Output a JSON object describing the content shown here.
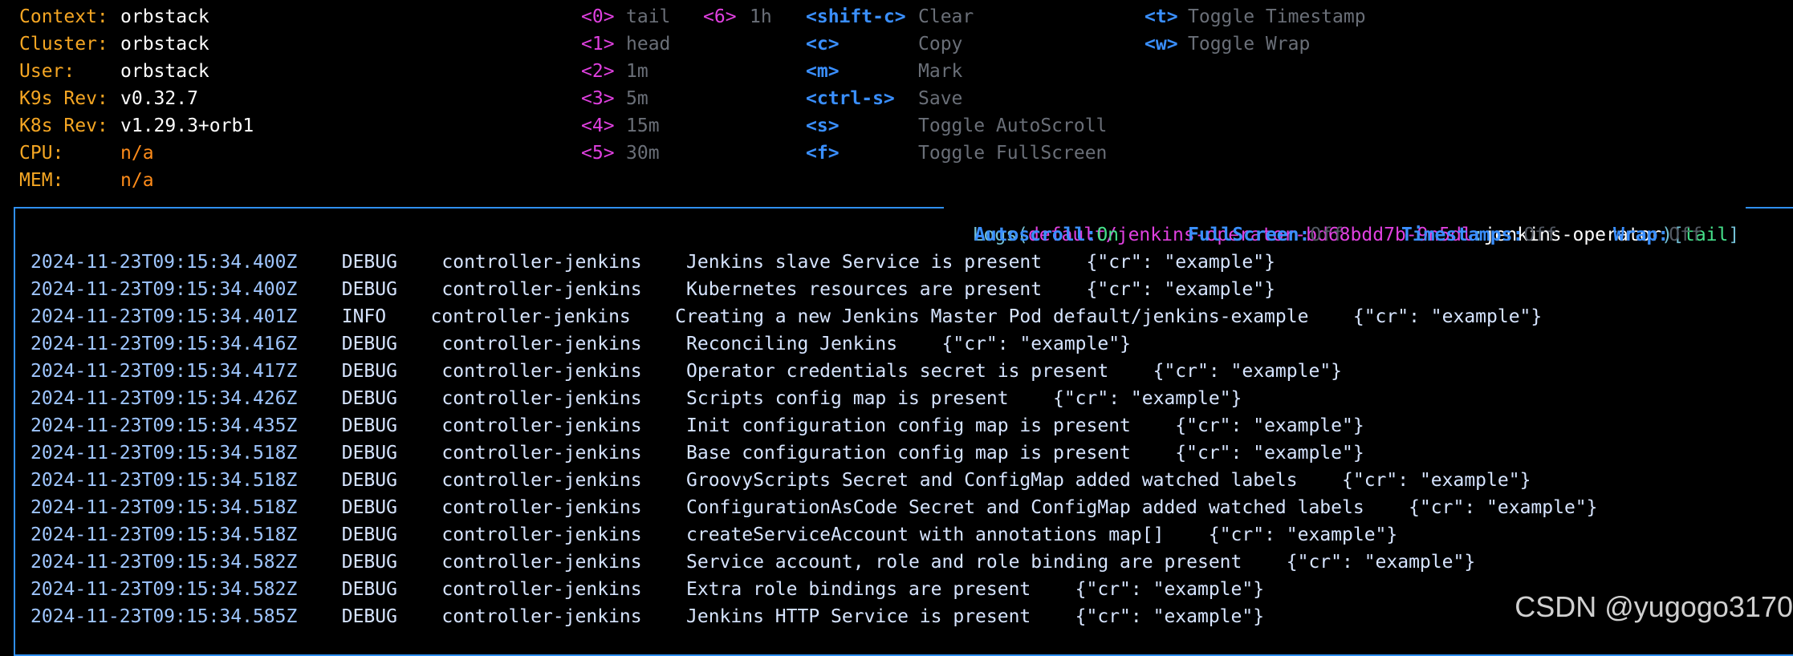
{
  "info": [
    {
      "label": "Context:",
      "value": "orbstack",
      "warn": false
    },
    {
      "label": "Cluster:",
      "value": "orbstack",
      "warn": false
    },
    {
      "label": "User:",
      "value": "orbstack",
      "warn": false
    },
    {
      "label": "K9s Rev:",
      "value": "v0.32.7",
      "warn": false
    },
    {
      "label": "K8s Rev:",
      "value": "v1.29.3+orb1",
      "warn": false
    },
    {
      "label": "CPU:",
      "value": "n/a",
      "warn": true
    },
    {
      "label": "MEM:",
      "value": "n/a",
      "warn": true
    }
  ],
  "time_keys": [
    {
      "key": "<0>",
      "label": "tail"
    },
    {
      "key": "<1>",
      "label": "head"
    },
    {
      "key": "<2>",
      "label": "1m"
    },
    {
      "key": "<3>",
      "label": "5m"
    },
    {
      "key": "<4>",
      "label": "15m"
    },
    {
      "key": "<5>",
      "label": "30m"
    }
  ],
  "time_key_extra": {
    "key": "<6>",
    "label": "1h"
  },
  "action_keys": [
    {
      "key": "<shift-c>",
      "label": "Clear"
    },
    {
      "key": "<c>",
      "label": "Copy"
    },
    {
      "key": "<m>",
      "label": "Mark"
    },
    {
      "key": "<ctrl-s>",
      "label": "Save"
    },
    {
      "key": "<s>",
      "label": "Toggle AutoScroll"
    },
    {
      "key": "<f>",
      "label": "Toggle FullScreen"
    }
  ],
  "toggle_keys": [
    {
      "key": "<t>",
      "label": "Toggle Timestamp"
    },
    {
      "key": "<w>",
      "label": "Toggle Wrap"
    }
  ],
  "title": {
    "prefix": "Logs(",
    "path": "default/jenkins-operator-bd68bdd7b-9n5dl",
    "sep": ":",
    "container": "jenkins-operator",
    "close": ")[",
    "mode": "tail",
    "end": "]"
  },
  "status": [
    {
      "label": "Autoscroll:",
      "value": "On",
      "on": true
    },
    {
      "label": "FullScreen:",
      "value": "Off",
      "on": false
    },
    {
      "label": "Timestamps:",
      "value": "Off",
      "on": false
    },
    {
      "label": "Wrap:",
      "value": "Off",
      "on": false
    }
  ],
  "logs": [
    {
      "ts": "2024-11-23T09:15:34.400Z",
      "level": "DEBUG",
      "logger": "controller-jenkins",
      "msg": "Jenkins slave Service is present",
      "ctx": "{\"cr\": \"example\"}"
    },
    {
      "ts": "2024-11-23T09:15:34.400Z",
      "level": "DEBUG",
      "logger": "controller-jenkins",
      "msg": "Kubernetes resources are present",
      "ctx": "{\"cr\": \"example\"}"
    },
    {
      "ts": "2024-11-23T09:15:34.401Z",
      "level": "INFO",
      "logger": "controller-jenkins",
      "msg": "Creating a new Jenkins Master Pod default/jenkins-example",
      "ctx": "{\"cr\": \"example\"}"
    },
    {
      "ts": "2024-11-23T09:15:34.416Z",
      "level": "DEBUG",
      "logger": "controller-jenkins",
      "msg": "Reconciling Jenkins",
      "ctx": "{\"cr\": \"example\"}"
    },
    {
      "ts": "2024-11-23T09:15:34.417Z",
      "level": "DEBUG",
      "logger": "controller-jenkins",
      "msg": "Operator credentials secret is present",
      "ctx": "{\"cr\": \"example\"}"
    },
    {
      "ts": "2024-11-23T09:15:34.426Z",
      "level": "DEBUG",
      "logger": "controller-jenkins",
      "msg": "Scripts config map is present",
      "ctx": "{\"cr\": \"example\"}"
    },
    {
      "ts": "2024-11-23T09:15:34.435Z",
      "level": "DEBUG",
      "logger": "controller-jenkins",
      "msg": "Init configuration config map is present",
      "ctx": "{\"cr\": \"example\"}"
    },
    {
      "ts": "2024-11-23T09:15:34.518Z",
      "level": "DEBUG",
      "logger": "controller-jenkins",
      "msg": "Base configuration config map is present",
      "ctx": "{\"cr\": \"example\"}"
    },
    {
      "ts": "2024-11-23T09:15:34.518Z",
      "level": "DEBUG",
      "logger": "controller-jenkins",
      "msg": "GroovyScripts Secret and ConfigMap added watched labels",
      "ctx": "{\"cr\": \"example\"}"
    },
    {
      "ts": "2024-11-23T09:15:34.518Z",
      "level": "DEBUG",
      "logger": "controller-jenkins",
      "msg": "ConfigurationAsCode Secret and ConfigMap added watched labels",
      "ctx": "{\"cr\": \"example\"}"
    },
    {
      "ts": "2024-11-23T09:15:34.518Z",
      "level": "DEBUG",
      "logger": "controller-jenkins",
      "msg": "createServiceAccount with annotations map[]",
      "ctx": "{\"cr\": \"example\"}"
    },
    {
      "ts": "2024-11-23T09:15:34.582Z",
      "level": "DEBUG",
      "logger": "controller-jenkins",
      "msg": "Service account, role and role binding are present",
      "ctx": "{\"cr\": \"example\"}"
    },
    {
      "ts": "2024-11-23T09:15:34.582Z",
      "level": "DEBUG",
      "logger": "controller-jenkins",
      "msg": "Extra role bindings are present",
      "ctx": "{\"cr\": \"example\"}"
    },
    {
      "ts": "2024-11-23T09:15:34.585Z",
      "level": "DEBUG",
      "logger": "controller-jenkins",
      "msg": "Jenkins HTTP Service is present",
      "ctx": "{\"cr\": \"example\"}"
    }
  ],
  "watermark": "CSDN @yugogo3170"
}
